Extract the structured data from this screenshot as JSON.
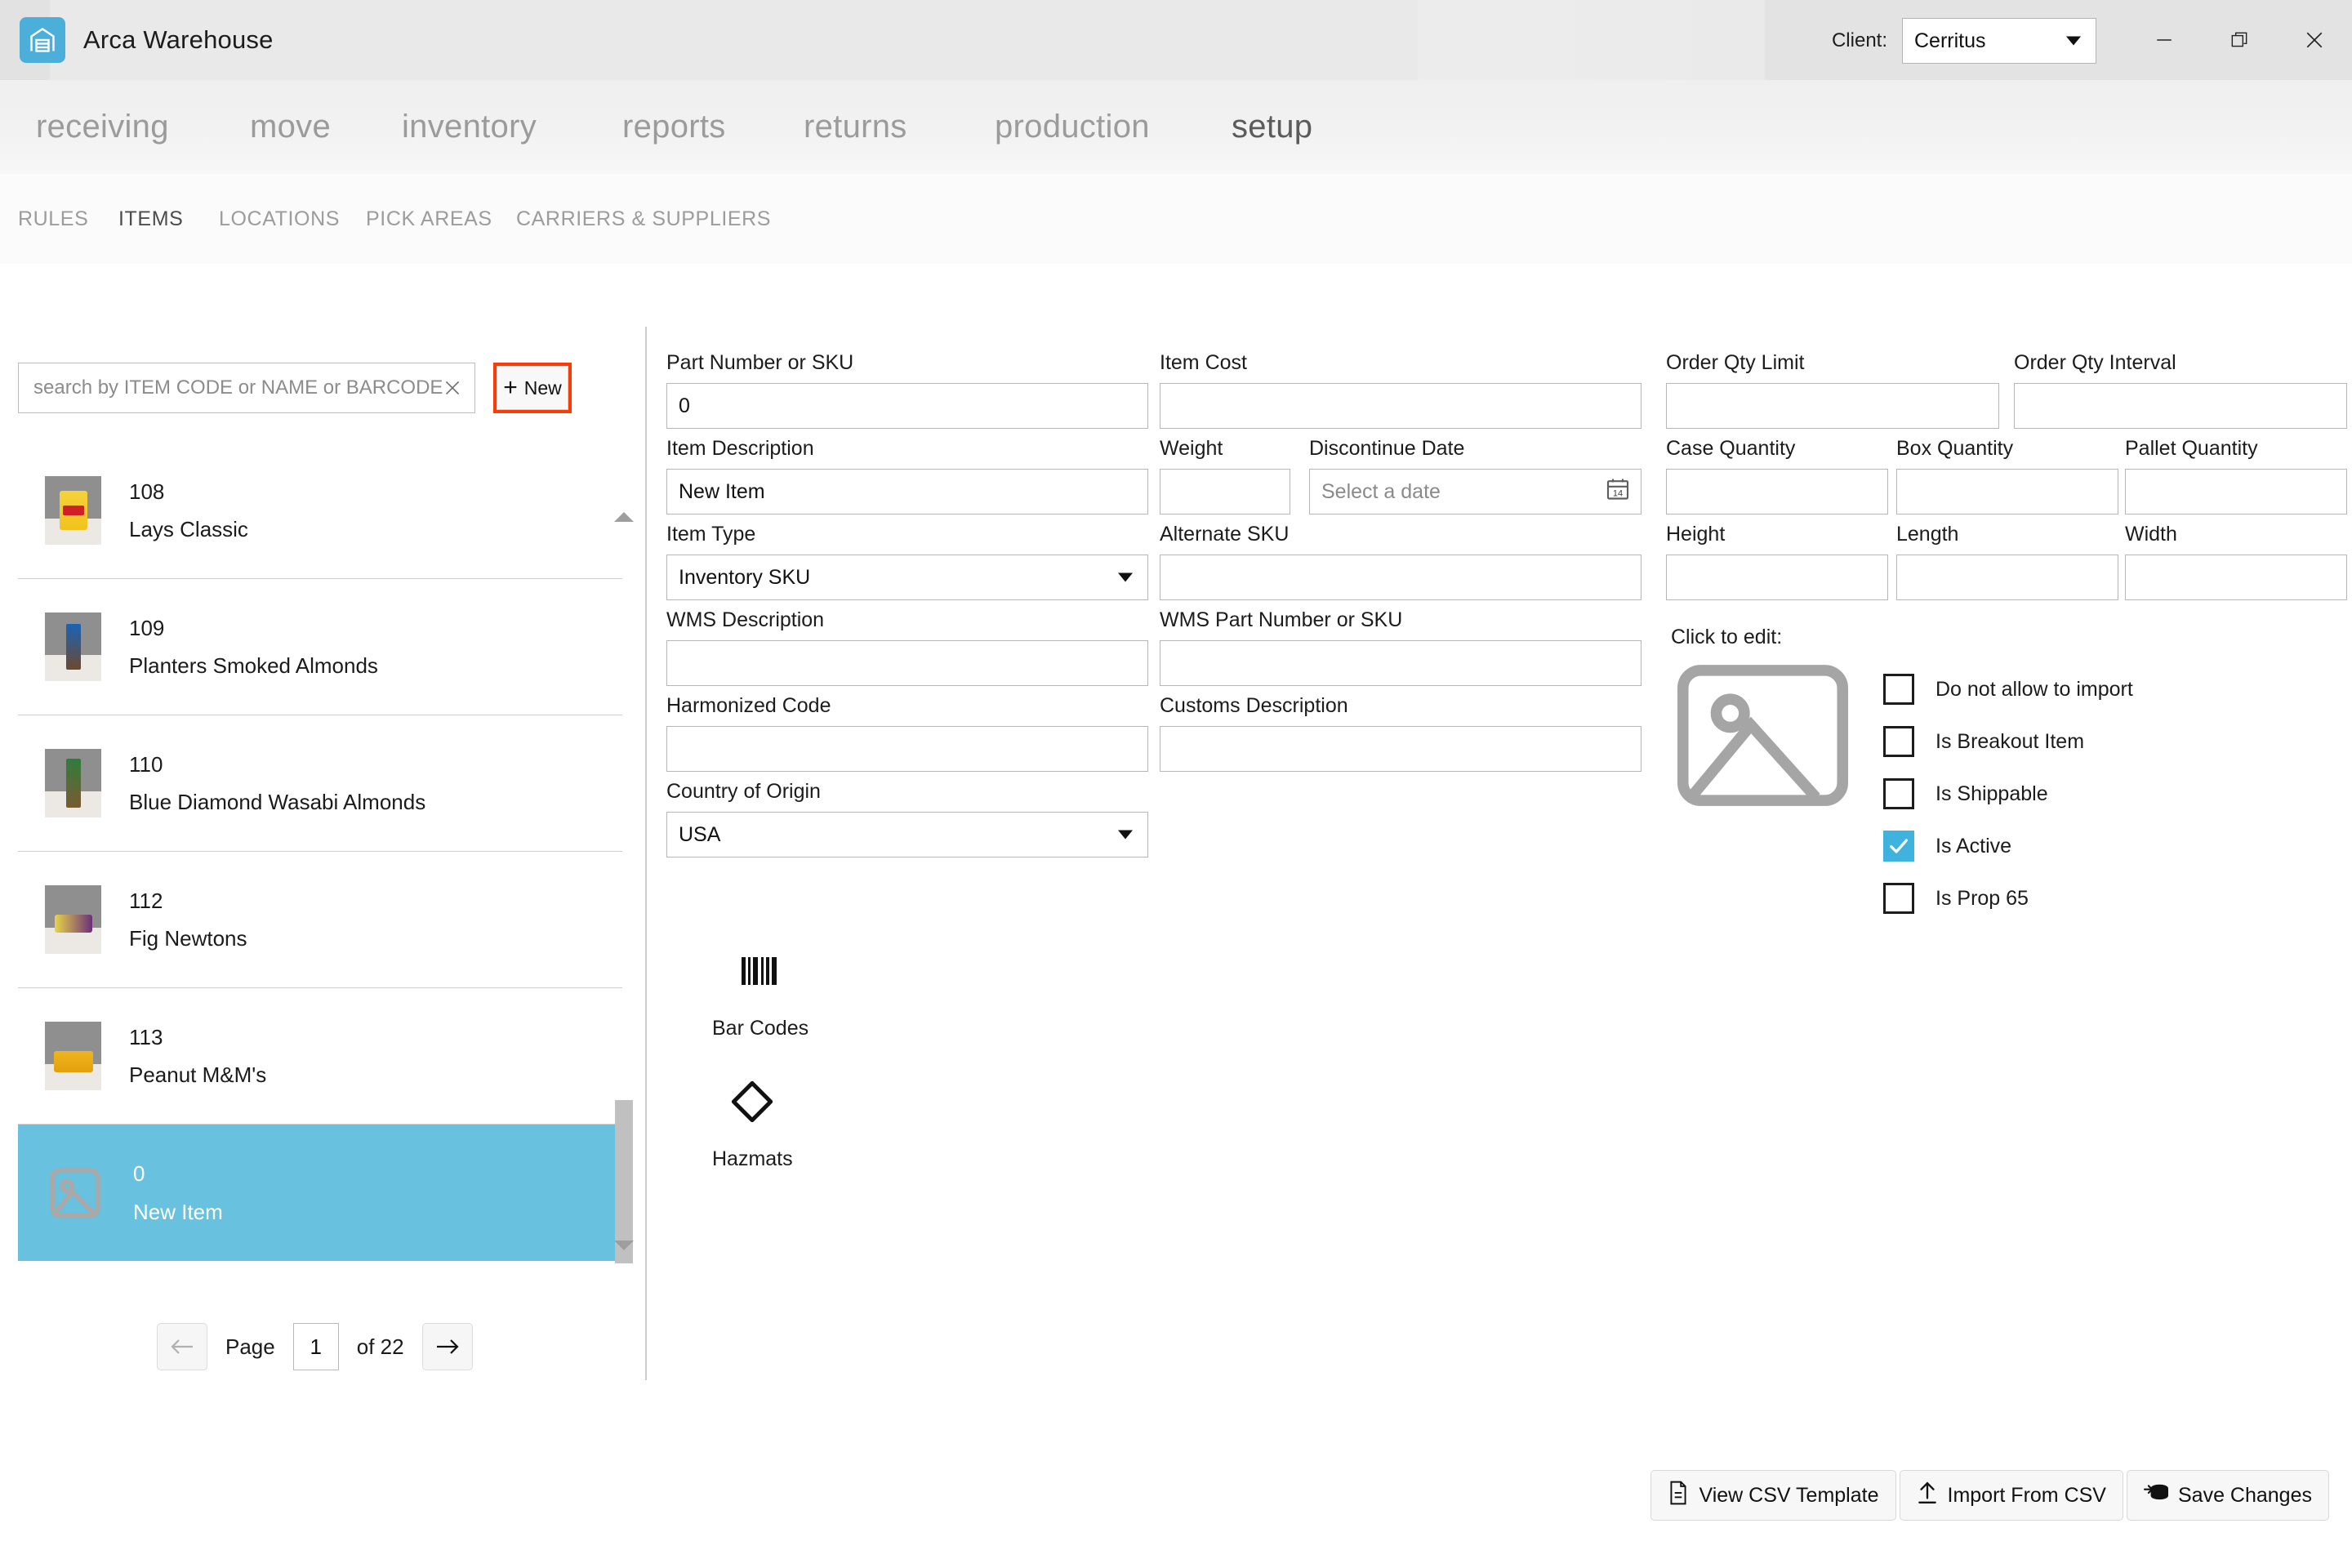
{
  "window": {
    "app_title": "Arca Warehouse",
    "logo_icon": "warehouse-icon",
    "client_label": "Client:",
    "client_value": "Cerritus",
    "minimize_icon": "minimize-icon",
    "restore_icon": "restore-icon",
    "close_icon": "close-icon"
  },
  "main_nav": {
    "items": [
      {
        "label": "receiving",
        "active": false
      },
      {
        "label": "move",
        "active": false
      },
      {
        "label": "inventory",
        "active": false
      },
      {
        "label": "reports",
        "active": false
      },
      {
        "label": "returns",
        "active": false
      },
      {
        "label": "production",
        "active": false
      },
      {
        "label": "setup",
        "active": true
      }
    ]
  },
  "sub_nav": {
    "items": [
      {
        "label": "RULES",
        "active": false
      },
      {
        "label": "ITEMS",
        "active": true
      },
      {
        "label": "LOCATIONS",
        "active": false
      },
      {
        "label": "PICK AREAS",
        "active": false
      },
      {
        "label": "CARRIERS & SUPPLIERS",
        "active": false
      }
    ]
  },
  "search": {
    "placeholder": "search by ITEM CODE or NAME or BARCODE",
    "value": "",
    "clear_icon": "close-icon",
    "new_label": "New",
    "new_plus": "+",
    "highlight_color": "#fa3d08"
  },
  "item_list": {
    "rows": [
      {
        "code": "108",
        "name": "Lays Classic",
        "selected": false,
        "has_photo": true
      },
      {
        "code": "109",
        "name": "Planters Smoked Almonds",
        "selected": false,
        "has_photo": true
      },
      {
        "code": "110",
        "name": "Blue Diamond Wasabi Almonds",
        "selected": false,
        "has_photo": true
      },
      {
        "code": "112",
        "name": "Fig Newtons",
        "selected": false,
        "has_photo": true
      },
      {
        "code": "113",
        "name": "Peanut M&M's",
        "selected": false,
        "has_photo": true
      },
      {
        "code": "0",
        "name": "New Item",
        "selected": true,
        "has_photo": false
      }
    ],
    "selected_color": "#67c1df",
    "scroll_up_icon": "chevron-up-icon",
    "scroll_down_icon": "chevron-down-icon"
  },
  "pager": {
    "prev_icon": "arrow-left-icon",
    "page_label": "Page",
    "page_value": "1",
    "of_label": "of",
    "total_pages": "22",
    "next_icon": "arrow-right-icon"
  },
  "form": {
    "part_number": {
      "label": "Part Number or SKU",
      "value": "0"
    },
    "item_description": {
      "label": "Item Description",
      "value": "New Item"
    },
    "item_type": {
      "label": "Item Type",
      "value": "Inventory SKU"
    },
    "wms_description": {
      "label": "WMS Description",
      "value": ""
    },
    "harmonized_code": {
      "label": "Harmonized Code",
      "value": ""
    },
    "country_of_origin": {
      "label": "Country of Origin",
      "value": "USA"
    },
    "item_cost": {
      "label": "Item Cost",
      "value": ""
    },
    "weight": {
      "label": "Weight",
      "value": ""
    },
    "discontinue_date": {
      "label": "Discontinue Date",
      "placeholder": "Select a date",
      "value": "",
      "calendar_icon": "calendar-icon",
      "calendar_day": "14"
    },
    "alternate_sku": {
      "label": "Alternate SKU",
      "value": ""
    },
    "wms_part_number": {
      "label": "WMS Part Number or SKU",
      "value": ""
    },
    "customs_description": {
      "label": "Customs Description",
      "value": ""
    },
    "order_qty_limit": {
      "label": "Order Qty Limit",
      "value": ""
    },
    "order_qty_interval": {
      "label": "Order Qty Interval",
      "value": ""
    },
    "case_quantity": {
      "label": "Case Quantity",
      "value": ""
    },
    "box_quantity": {
      "label": "Box Quantity",
      "value": ""
    },
    "pallet_quantity": {
      "label": "Pallet Quantity",
      "value": ""
    },
    "height": {
      "label": "Height",
      "value": ""
    },
    "length": {
      "label": "Length",
      "value": ""
    },
    "width": {
      "label": "Width",
      "value": ""
    }
  },
  "sub_sections": {
    "barcodes": {
      "label": "Bar Codes",
      "icon": "barcode-icon"
    },
    "hazmats": {
      "label": "Hazmats",
      "icon": "diamond-icon"
    }
  },
  "image_edit": {
    "label": "Click to edit:",
    "placeholder_icon": "image-placeholder-icon"
  },
  "checkboxes": {
    "accent_color": "#3fb3dd",
    "items": [
      {
        "label": "Do not allow to import",
        "checked": false
      },
      {
        "label": "Is Breakout Item",
        "checked": false
      },
      {
        "label": "Is Shippable",
        "checked": false
      },
      {
        "label": "Is Active",
        "checked": true
      },
      {
        "label": "Is Prop 65",
        "checked": false
      }
    ]
  },
  "footer": {
    "buttons": [
      {
        "label": "View CSV Template",
        "icon": "document-icon"
      },
      {
        "label": "Import From CSV",
        "icon": "upload-icon"
      },
      {
        "label": "Save Changes",
        "icon": "database-save-icon"
      }
    ]
  }
}
